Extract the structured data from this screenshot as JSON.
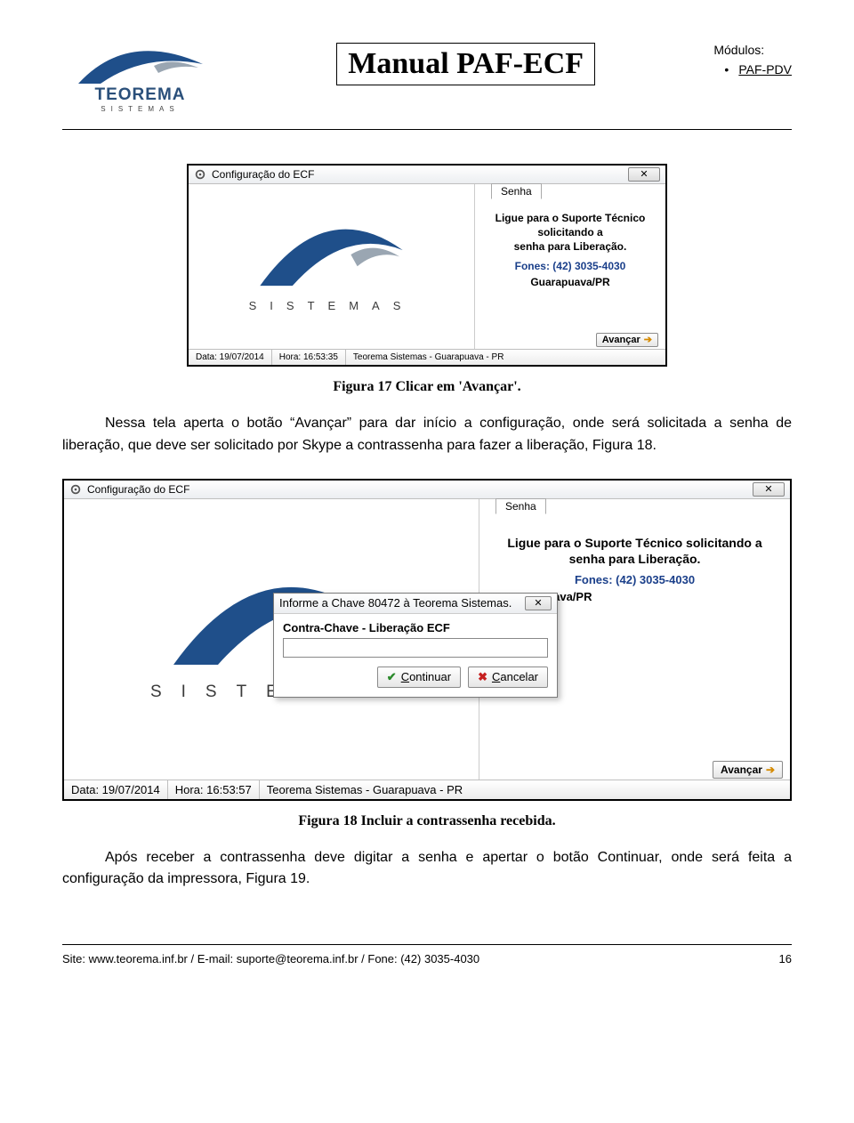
{
  "header": {
    "logo_name": "TEOREMA",
    "logo_sub": "SISTEMAS",
    "title": "Manual PAF-ECF",
    "mod_label": "Módulos:",
    "mod_item": "PAF-PDV"
  },
  "fig1": {
    "window_title": "Configuração do ECF",
    "close": "✕",
    "sistemas": "SISTEMAS",
    "tab": "Senha",
    "info_l1": "Ligue para o Suporte Técnico solicitando a",
    "info_l2": "senha para Liberação.",
    "fones": "Fones: (42) 3035-4030",
    "city": "Guarapuava/PR",
    "avancar": "Avançar",
    "status_data": "Data: 19/07/2014",
    "status_hora": "Hora: 16:53:35",
    "status_org": "Teorema Sistemas - Guarapuava - PR",
    "caption": "Figura 17 Clicar em 'Avançar'."
  },
  "para1": "Nessa tela aperta o botão “Avançar” para dar início a configuração, onde será solicitada a senha de liberação, que deve ser solicitado por Skype a contrassenha para fazer a liberação, Figura 18.",
  "fig2": {
    "window_title": "Configuração do ECF",
    "close": "✕",
    "sistemas": "SISTEMAS",
    "tab": "Senha",
    "info_l1": "Ligue para o Suporte Técnico solicitando a",
    "info_l2": "senha para Liberação.",
    "fones": "Fones: (42) 3035-4030",
    "city_cut": "apuava/PR",
    "dialog_title": "Informe a Chave 80472 à Teorema Sistemas.",
    "dialog_close": "✕",
    "dlabel": "Contra-Chave - Liberação ECF",
    "btn_cont": "Continuar",
    "btn_canc": "Cancelar",
    "avancar": "Avançar",
    "status_data": "Data: 19/07/2014",
    "status_hora": "Hora: 16:53:57",
    "status_org": "Teorema Sistemas - Guarapuava - PR",
    "caption": "Figura 18 Incluir a contrassenha recebida."
  },
  "para2": "Após receber a contrassenha deve digitar a senha e apertar o botão Continuar, onde será feita a configuração da impressora, Figura 19.",
  "footer": {
    "left": "Site: www.teorema.inf.br / E-mail: suporte@teorema.inf.br / Fone: (42) 3035-4030",
    "page": "16"
  }
}
